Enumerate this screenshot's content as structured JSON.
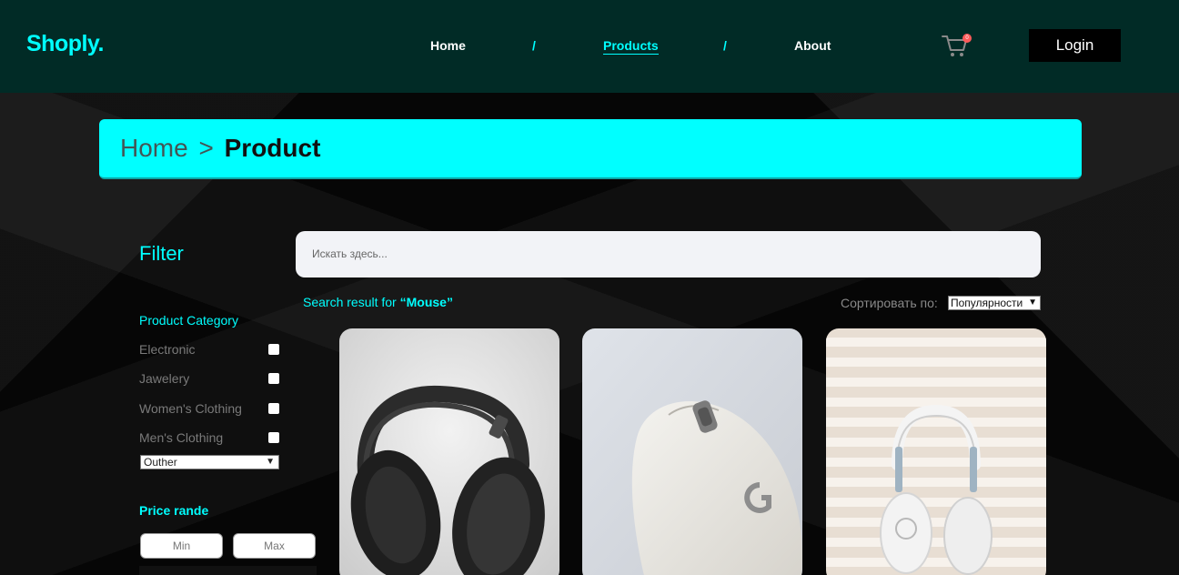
{
  "header": {
    "logo": "Shoply.",
    "nav": [
      {
        "label": "Home",
        "active": false
      },
      {
        "label": "Products",
        "active": true
      },
      {
        "label": "About",
        "active": false
      }
    ],
    "nav_separator": "/",
    "cart_count": "0",
    "login_label": "Login"
  },
  "breadcrumb": {
    "home": "Home",
    "separator": ">",
    "current": "Product"
  },
  "filter": {
    "title": "Filter",
    "category_title": "Product Category",
    "categories": [
      "Electronic",
      "Jawelery",
      "Women's Clothing",
      "Men's Clothing"
    ],
    "other_select": "Outher",
    "price_title": "Price rande",
    "min_placeholder": "Min",
    "max_placeholder": "Max"
  },
  "search": {
    "placeholder": "Искать здесь...",
    "result_prefix": "Search result for ",
    "query": "“Mouse”"
  },
  "sort": {
    "label": "Сортировать по:",
    "selected": "Популярности"
  },
  "products": [
    {
      "icon": "headphones-black-image"
    },
    {
      "icon": "mouse-white-image"
    },
    {
      "icon": "headphones-white-image"
    }
  ],
  "colors": {
    "accent": "#00ffff",
    "header_bg": "#012b26",
    "page_bg": "#050505"
  }
}
